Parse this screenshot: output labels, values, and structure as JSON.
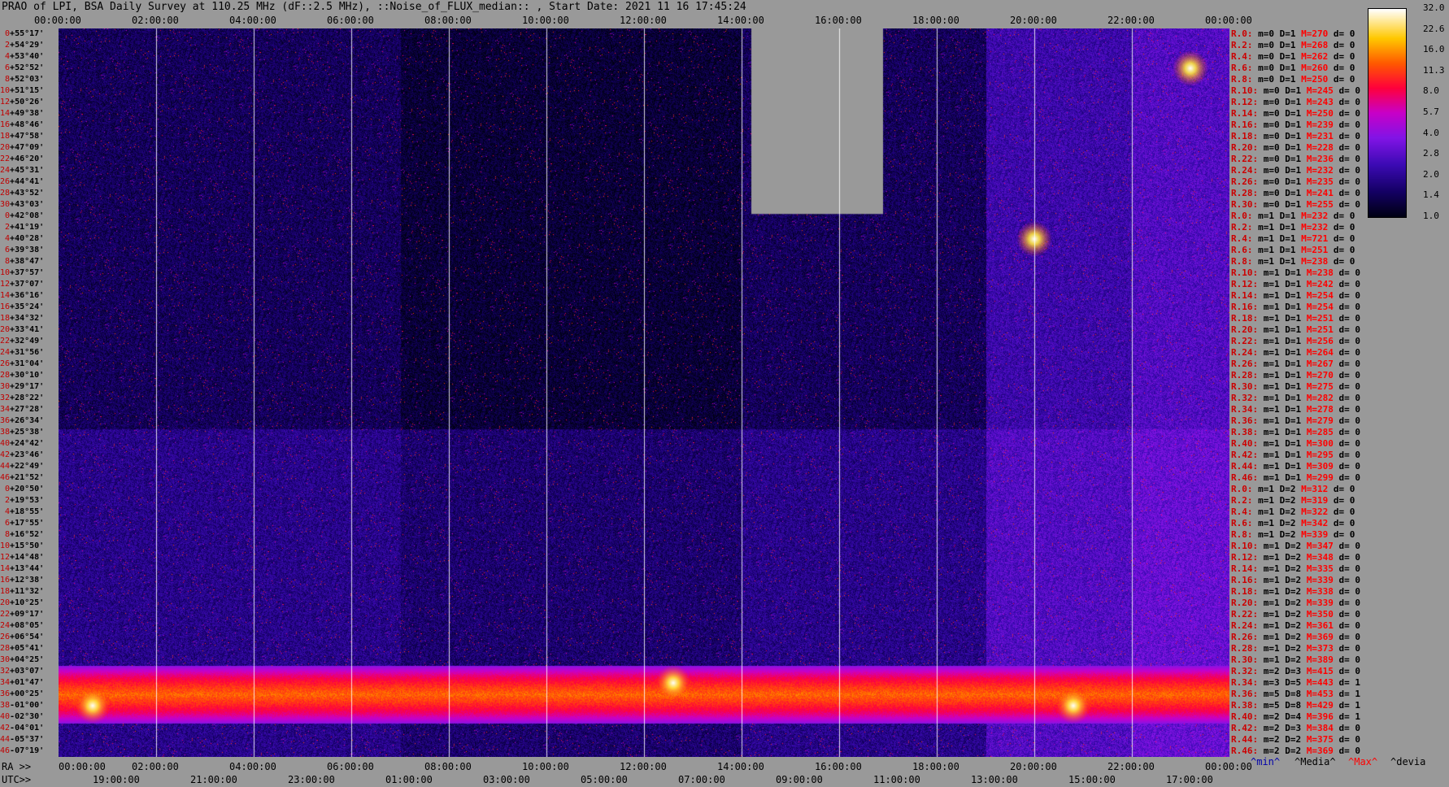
{
  "title": "PRAO of LPI, BSA Daily Survey at 110.25 MHz (dF::2.5 MHz), ::Noise_of_FLUX_median:: , Start Date: 2021 11 16 17:45:24",
  "top_ticks": [
    "00:00:00",
    "02:00:00",
    "04:00:00",
    "06:00:00",
    "08:00:00",
    "10:00:00",
    "12:00:00",
    "14:00:00",
    "16:00:00",
    "18:00:00",
    "20:00:00",
    "22:00:00",
    "00:00:00"
  ],
  "bottom_ra_label": "RA >>",
  "bottom_ra_ticks": [
    "00:00:00",
    "02:00:00",
    "04:00:00",
    "06:00:00",
    "08:00:00",
    "10:00:00",
    "12:00:00",
    "14:00:00",
    "16:00:00",
    "18:00:00",
    "20:00:00",
    "22:00:00",
    "00:00:00"
  ],
  "bottom_utc_label": "UTC>>",
  "bottom_utc_ticks": [
    "19:00:00",
    "21:00:00",
    "23:00:00",
    "01:00:00",
    "03:00:00",
    "05:00:00",
    "07:00:00",
    "09:00:00",
    "11:00:00",
    "13:00:00",
    "15:00:00",
    "17:00:00"
  ],
  "declinations": [
    {
      "i": "0",
      "d": "+55°17'"
    },
    {
      "i": "2",
      "d": "+54°29'"
    },
    {
      "i": "4",
      "d": "+53°40'"
    },
    {
      "i": "6",
      "d": "+52°52'"
    },
    {
      "i": "8",
      "d": "+52°03'"
    },
    {
      "i": "10",
      "d": "+51°15'"
    },
    {
      "i": "12",
      "d": "+50°26'"
    },
    {
      "i": "14",
      "d": "+49°38'"
    },
    {
      "i": "16",
      "d": "+48°46'"
    },
    {
      "i": "18",
      "d": "+47°58'"
    },
    {
      "i": "20",
      "d": "+47°09'"
    },
    {
      "i": "22",
      "d": "+46°20'"
    },
    {
      "i": "24",
      "d": "+45°31'"
    },
    {
      "i": "26",
      "d": "+44°41'"
    },
    {
      "i": "28",
      "d": "+43°52'"
    },
    {
      "i": "30",
      "d": "+43°03'"
    },
    {
      "i": "0",
      "d": "+42°08'"
    },
    {
      "i": "2",
      "d": "+41°19'"
    },
    {
      "i": "4",
      "d": "+40°28'"
    },
    {
      "i": "6",
      "d": "+39°38'"
    },
    {
      "i": "8",
      "d": "+38°47'"
    },
    {
      "i": "10",
      "d": "+37°57'"
    },
    {
      "i": "12",
      "d": "+37°07'"
    },
    {
      "i": "14",
      "d": "+36°16'"
    },
    {
      "i": "16",
      "d": "+35°24'"
    },
    {
      "i": "18",
      "d": "+34°32'"
    },
    {
      "i": "20",
      "d": "+33°41'"
    },
    {
      "i": "22",
      "d": "+32°49'"
    },
    {
      "i": "24",
      "d": "+31°56'"
    },
    {
      "i": "26",
      "d": "+31°04'"
    },
    {
      "i": "28",
      "d": "+30°10'"
    },
    {
      "i": "30",
      "d": "+29°17'"
    },
    {
      "i": "32",
      "d": "+28°22'"
    },
    {
      "i": "34",
      "d": "+27°28'"
    },
    {
      "i": "36",
      "d": "+26°34'"
    },
    {
      "i": "38",
      "d": "+25°38'"
    },
    {
      "i": "40",
      "d": "+24°42'"
    },
    {
      "i": "42",
      "d": "+23°46'"
    },
    {
      "i": "44",
      "d": "+22°49'"
    },
    {
      "i": "46",
      "d": "+21°52'"
    },
    {
      "i": "0",
      "d": "+20°50'"
    },
    {
      "i": "2",
      "d": "+19°53'"
    },
    {
      "i": "4",
      "d": "+18°55'"
    },
    {
      "i": "6",
      "d": "+17°55'"
    },
    {
      "i": "8",
      "d": "+16°52'"
    },
    {
      "i": "10",
      "d": "+15°50'"
    },
    {
      "i": "12",
      "d": "+14°48'"
    },
    {
      "i": "14",
      "d": "+13°44'"
    },
    {
      "i": "16",
      "d": "+12°38'"
    },
    {
      "i": "18",
      "d": "+11°32'"
    },
    {
      "i": "20",
      "d": "+10°25'"
    },
    {
      "i": "22",
      "d": "+09°17'"
    },
    {
      "i": "24",
      "d": "+08°05'"
    },
    {
      "i": "26",
      "d": "+06°54'"
    },
    {
      "i": "28",
      "d": "+05°41'"
    },
    {
      "i": "30",
      "d": "+04°25'"
    },
    {
      "i": "32",
      "d": "+03°07'"
    },
    {
      "i": "34",
      "d": "+01°47'"
    },
    {
      "i": "36",
      "d": "+00°25'"
    },
    {
      "i": "38",
      "d": "-01°00'"
    },
    {
      "i": "40",
      "d": "-02°30'"
    },
    {
      "i": "42",
      "d": "-04°01'"
    },
    {
      "i": "44",
      "d": "-05°37'"
    },
    {
      "i": "46",
      "d": "-07°19'"
    }
  ],
  "row_info": [
    {
      "r": "R.0:",
      "m": "0",
      "D": "1",
      "M": "270",
      "d": "0"
    },
    {
      "r": "R.2:",
      "m": "0",
      "D": "1",
      "M": "268",
      "d": "0"
    },
    {
      "r": "R.4:",
      "m": "0",
      "D": "1",
      "M": "262",
      "d": "0"
    },
    {
      "r": "R.6:",
      "m": "0",
      "D": "1",
      "M": "260",
      "d": "0"
    },
    {
      "r": "R.8:",
      "m": "0",
      "D": "1",
      "M": "250",
      "d": "0"
    },
    {
      "r": "R.10:",
      "m": "0",
      "D": "1",
      "M": "245",
      "d": "0"
    },
    {
      "r": "R.12:",
      "m": "0",
      "D": "1",
      "M": "243",
      "d": "0"
    },
    {
      "r": "R.14:",
      "m": "0",
      "D": "1",
      "M": "250",
      "d": "0"
    },
    {
      "r": "R.16:",
      "m": "0",
      "D": "1",
      "M": "239",
      "d": "0"
    },
    {
      "r": "R.18:",
      "m": "0",
      "D": "1",
      "M": "231",
      "d": "0"
    },
    {
      "r": "R.20:",
      "m": "0",
      "D": "1",
      "M": "228",
      "d": "0"
    },
    {
      "r": "R.22:",
      "m": "0",
      "D": "1",
      "M": "236",
      "d": "0"
    },
    {
      "r": "R.24:",
      "m": "0",
      "D": "1",
      "M": "232",
      "d": "0"
    },
    {
      "r": "R.26:",
      "m": "0",
      "D": "1",
      "M": "235",
      "d": "0"
    },
    {
      "r": "R.28:",
      "m": "0",
      "D": "1",
      "M": "241",
      "d": "0"
    },
    {
      "r": "R.30:",
      "m": "0",
      "D": "1",
      "M": "255",
      "d": "0"
    },
    {
      "r": "R.0:",
      "m": "1",
      "D": "1",
      "M": "232",
      "d": "0"
    },
    {
      "r": "R.2:",
      "m": "1",
      "D": "1",
      "M": "232",
      "d": "0"
    },
    {
      "r": "R.4:",
      "m": "1",
      "D": "1",
      "M": "721",
      "d": "0"
    },
    {
      "r": "R.6:",
      "m": "1",
      "D": "1",
      "M": "251",
      "d": "0"
    },
    {
      "r": "R.8:",
      "m": "1",
      "D": "1",
      "M": "238",
      "d": "0"
    },
    {
      "r": "R.10:",
      "m": "1",
      "D": "1",
      "M": "238",
      "d": "0"
    },
    {
      "r": "R.12:",
      "m": "1",
      "D": "1",
      "M": "242",
      "d": "0"
    },
    {
      "r": "R.14:",
      "m": "1",
      "D": "1",
      "M": "254",
      "d": "0"
    },
    {
      "r": "R.16:",
      "m": "1",
      "D": "1",
      "M": "254",
      "d": "0"
    },
    {
      "r": "R.18:",
      "m": "1",
      "D": "1",
      "M": "251",
      "d": "0"
    },
    {
      "r": "R.20:",
      "m": "1",
      "D": "1",
      "M": "251",
      "d": "0"
    },
    {
      "r": "R.22:",
      "m": "1",
      "D": "1",
      "M": "256",
      "d": "0"
    },
    {
      "r": "R.24:",
      "m": "1",
      "D": "1",
      "M": "264",
      "d": "0"
    },
    {
      "r": "R.26:",
      "m": "1",
      "D": "1",
      "M": "267",
      "d": "0"
    },
    {
      "r": "R.28:",
      "m": "1",
      "D": "1",
      "M": "270",
      "d": "0"
    },
    {
      "r": "R.30:",
      "m": "1",
      "D": "1",
      "M": "275",
      "d": "0"
    },
    {
      "r": "R.32:",
      "m": "1",
      "D": "1",
      "M": "282",
      "d": "0"
    },
    {
      "r": "R.34:",
      "m": "1",
      "D": "1",
      "M": "278",
      "d": "0"
    },
    {
      "r": "R.36:",
      "m": "1",
      "D": "1",
      "M": "279",
      "d": "0"
    },
    {
      "r": "R.38:",
      "m": "1",
      "D": "1",
      "M": "285",
      "d": "0"
    },
    {
      "r": "R.40:",
      "m": "1",
      "D": "1",
      "M": "300",
      "d": "0"
    },
    {
      "r": "R.42:",
      "m": "1",
      "D": "1",
      "M": "295",
      "d": "0"
    },
    {
      "r": "R.44:",
      "m": "1",
      "D": "1",
      "M": "309",
      "d": "0"
    },
    {
      "r": "R.46:",
      "m": "1",
      "D": "1",
      "M": "299",
      "d": "0"
    },
    {
      "r": "R.0:",
      "m": "1",
      "D": "2",
      "M": "312",
      "d": "0"
    },
    {
      "r": "R.2:",
      "m": "1",
      "D": "2",
      "M": "319",
      "d": "0"
    },
    {
      "r": "R.4:",
      "m": "1",
      "D": "2",
      "M": "322",
      "d": "0"
    },
    {
      "r": "R.6:",
      "m": "1",
      "D": "2",
      "M": "342",
      "d": "0"
    },
    {
      "r": "R.8:",
      "m": "1",
      "D": "2",
      "M": "339",
      "d": "0"
    },
    {
      "r": "R.10:",
      "m": "1",
      "D": "2",
      "M": "347",
      "d": "0"
    },
    {
      "r": "R.12:",
      "m": "1",
      "D": "2",
      "M": "348",
      "d": "0"
    },
    {
      "r": "R.14:",
      "m": "1",
      "D": "2",
      "M": "335",
      "d": "0"
    },
    {
      "r": "R.16:",
      "m": "1",
      "D": "2",
      "M": "339",
      "d": "0"
    },
    {
      "r": "R.18:",
      "m": "1",
      "D": "2",
      "M": "338",
      "d": "0"
    },
    {
      "r": "R.20:",
      "m": "1",
      "D": "2",
      "M": "339",
      "d": "0"
    },
    {
      "r": "R.22:",
      "m": "1",
      "D": "2",
      "M": "350",
      "d": "0"
    },
    {
      "r": "R.24:",
      "m": "1",
      "D": "2",
      "M": "361",
      "d": "0"
    },
    {
      "r": "R.26:",
      "m": "1",
      "D": "2",
      "M": "369",
      "d": "0"
    },
    {
      "r": "R.28:",
      "m": "1",
      "D": "2",
      "M": "373",
      "d": "0"
    },
    {
      "r": "R.30:",
      "m": "1",
      "D": "2",
      "M": "389",
      "d": "0"
    },
    {
      "r": "R.32:",
      "m": "2",
      "D": "3",
      "M": "415",
      "d": "0"
    },
    {
      "r": "R.34:",
      "m": "3",
      "D": "5",
      "M": "443",
      "d": "1"
    },
    {
      "r": "R.36:",
      "m": "5",
      "D": "8",
      "M": "453",
      "d": "1"
    },
    {
      "r": "R.38:",
      "m": "5",
      "D": "8",
      "M": "429",
      "d": "1"
    },
    {
      "r": "R.40:",
      "m": "2",
      "D": "4",
      "M": "396",
      "d": "1"
    },
    {
      "r": "R.42:",
      "m": "2",
      "D": "3",
      "M": "384",
      "d": "0"
    },
    {
      "r": "R.44:",
      "m": "2",
      "D": "2",
      "M": "375",
      "d": "0"
    },
    {
      "r": "R.46:",
      "m": "2",
      "D": "2",
      "M": "369",
      "d": "0"
    }
  ],
  "legend_bottom": {
    "min": "^min^",
    "median": "^Media^",
    "max": "^Max^",
    "devia": "^devia"
  },
  "colorbar": {
    "ticks": [
      "32.0",
      "22.6",
      "16.0",
      "11.3",
      "8.0",
      "5.7",
      "4.0",
      "2.8",
      "2.0",
      "1.4",
      "1.0"
    ]
  },
  "chart_data": {
    "type": "heatmap",
    "title": "PRAO of LPI, BSA Daily Survey at 110.25 MHz (dF::2.5 MHz), ::Noise_of_FLUX_median:: , Start Date: 2021 11 16 17:45:24",
    "x_ticks_ra": [
      "00:00:00",
      "02:00:00",
      "04:00:00",
      "06:00:00",
      "08:00:00",
      "10:00:00",
      "12:00:00",
      "14:00:00",
      "16:00:00",
      "18:00:00",
      "20:00:00",
      "22:00:00",
      "00:00:00"
    ],
    "x_ticks_utc": [
      "19:00:00",
      "21:00:00",
      "23:00:00",
      "01:00:00",
      "03:00:00",
      "05:00:00",
      "07:00:00",
      "09:00:00",
      "11:00:00",
      "13:00:00",
      "15:00:00",
      "17:00:00"
    ],
    "y_range_declination": [
      "+55°17'",
      "-07°19'"
    ],
    "colorscale_range": [
      1.0,
      32.0
    ],
    "colorscale": "log",
    "missing_data_block": {
      "ra_start_hours": 14.2,
      "ra_end_hours": 16.9,
      "declination_from": "+55°17'",
      "declination_to": "+42°08'"
    },
    "bright_band_declination": [
      "+03°07'",
      "-02°30'"
    ],
    "bright_sources": [
      {
        "ra_hours": 20.0,
        "dec": "+40°28'",
        "level": 32.0
      },
      {
        "ra_hours": 0.7,
        "dec": "-01°00'",
        "level": 22.6
      },
      {
        "ra_hours": 12.6,
        "dec": "+01°47'",
        "level": 16.0
      },
      {
        "ra_hours": 20.8,
        "dec": "-01°00'",
        "level": 22.6
      },
      {
        "ra_hours": 23.2,
        "dec": "+52°52'",
        "level": 16.0
      }
    ]
  }
}
